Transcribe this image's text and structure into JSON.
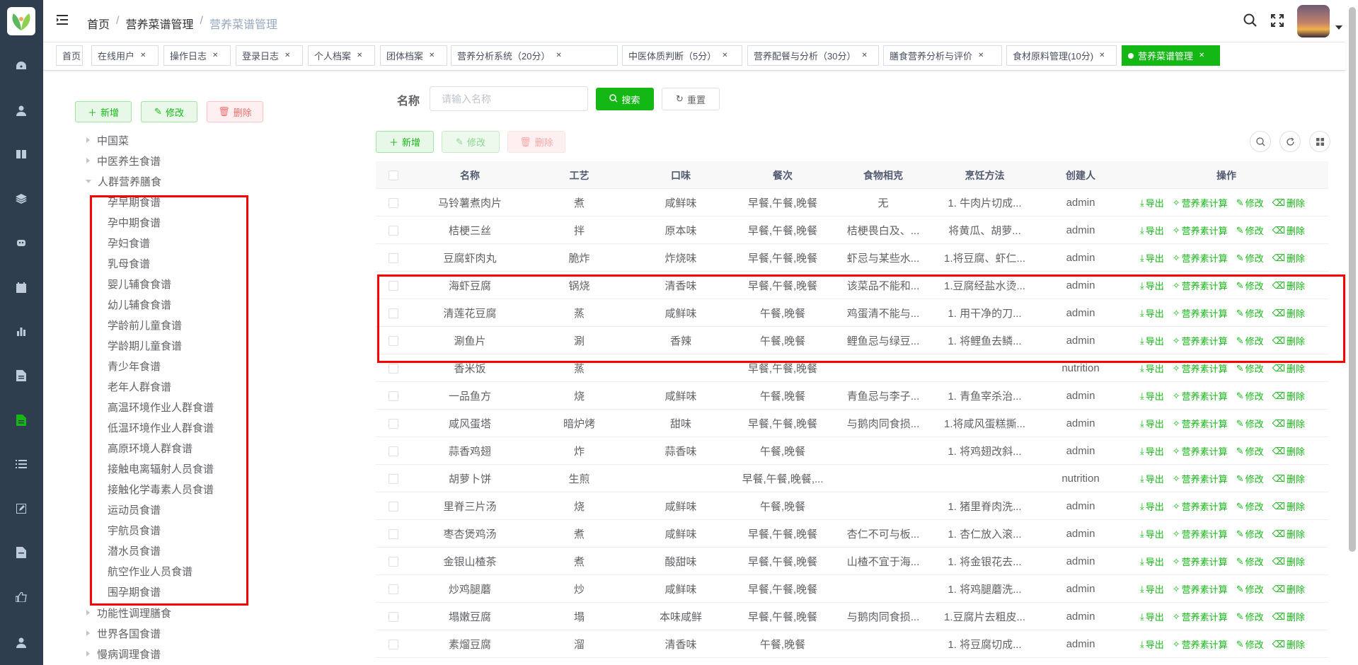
{
  "breadcrumb": {
    "home": "首页",
    "parent": "营养菜谱管理",
    "current": "营养菜谱管理"
  },
  "tags": [
    {
      "label": "首页",
      "closable": false
    },
    {
      "label": "在线用户",
      "closable": true
    },
    {
      "label": "操作日志",
      "closable": true
    },
    {
      "label": "登录日志",
      "closable": true
    },
    {
      "label": "个人档案",
      "closable": true
    },
    {
      "label": "团体档案",
      "closable": true
    },
    {
      "label": "营养分析系统（20分）",
      "closable": true
    },
    {
      "label": "中医体质判断（5分）",
      "closable": true
    },
    {
      "label": "营养配餐与分析（30分）",
      "closable": true
    },
    {
      "label": "膳食营养分析与评价",
      "closable": true
    },
    {
      "label": "食材原料管理(10分)",
      "closable": true
    },
    {
      "label": "营养菜谱管理",
      "closable": true,
      "active": true
    }
  ],
  "tree_toolbar": {
    "add": "新增",
    "edit": "修改",
    "delete": "删除"
  },
  "tree": {
    "top": [
      {
        "label": "中国菜",
        "expanded": false
      },
      {
        "label": "中医养生食谱",
        "expanded": false
      },
      {
        "label": "人群营养膳食",
        "expanded": true
      }
    ],
    "children": [
      "孕早期食谱",
      "孕中期食谱",
      "孕妇食谱",
      "乳母食谱",
      "婴儿辅食食谱",
      "幼儿辅食食谱",
      "学龄前儿童食谱",
      "学龄期儿童食谱",
      "青少年食谱",
      "老年人群食谱",
      "高温环境作业人群食谱",
      "低温环境作业人群食谱",
      "高原环境人群食谱",
      "接触电离辐射人员食谱",
      "接触化学毒素人员食谱",
      "运动员食谱",
      "宇航员食谱",
      "潜水员食谱",
      "航空作业人员食谱",
      "围孕期食谱"
    ],
    "bottom": [
      {
        "label": "功能性调理膳食",
        "expanded": false
      },
      {
        "label": "世界各国食谱",
        "expanded": false
      },
      {
        "label": "慢病调理食谱",
        "expanded": false
      }
    ]
  },
  "search": {
    "label": "名称",
    "placeholder": "请输入名称",
    "search_btn": "搜索",
    "reset_btn": "重置"
  },
  "table_toolbar": {
    "add": "新增",
    "edit": "修改",
    "delete": "删除"
  },
  "table": {
    "headers": [
      "名称",
      "工艺",
      "口味",
      "餐次",
      "食物相克",
      "烹饪方法",
      "创建人",
      "操作"
    ],
    "ops": {
      "export": "导出",
      "calc": "营养素计算",
      "edit": "修改",
      "delete": "删除"
    },
    "rows": [
      [
        "马铃薯煮肉片",
        "煮",
        "咸鲜味",
        "早餐,午餐,晚餐",
        "无",
        "1. 牛肉片切成...",
        "admin"
      ],
      [
        "桔梗三丝",
        "拌",
        "原本味",
        "早餐,午餐,晚餐",
        "桔梗畏白及、...",
        "将黄瓜、胡萝...",
        "admin"
      ],
      [
        "豆腐虾肉丸",
        "脆炸",
        "炸烧味",
        "早餐,午餐,晚餐",
        "虾忌与某些水...",
        "1.将豆腐、虾仁...",
        "admin"
      ],
      [
        "海虾豆腐",
        "锅烧",
        "清香味",
        "早餐,午餐,晚餐",
        "该菜品不能和...",
        "1.豆腐经盐水烫...",
        "admin"
      ],
      [
        "清莲花豆腐",
        "蒸",
        "咸鲜味",
        "午餐,晚餐",
        "鸡蛋清不能与...",
        "1. 用干净的刀...",
        "admin"
      ],
      [
        "涮鱼片",
        "涮",
        "香辣",
        "午餐,晚餐",
        "鲤鱼忌与绿豆...",
        "1. 将鲤鱼去鳞...",
        "admin"
      ],
      [
        "香米饭",
        "蒸",
        "",
        "早餐,午餐,晚餐",
        "",
        "",
        "nutrition"
      ],
      [
        "一品鱼方",
        "烧",
        "咸鲜味",
        "午餐,晚餐",
        "青鱼忌与李子...",
        "1. 青鱼宰杀治...",
        "admin"
      ],
      [
        "咸风蛋塔",
        "暗炉烤",
        "甜味",
        "早餐,午餐,晚餐",
        "与鹅肉同食损...",
        "1.将咸风蛋糕撕...",
        "admin"
      ],
      [
        "蒜香鸡翅",
        "炸",
        "蒜香味",
        "午餐,晚餐",
        "",
        "1. 将鸡翅改斜...",
        "admin"
      ],
      [
        "胡萝卜饼",
        "生煎",
        "",
        "早餐,午餐,晚餐,...",
        "",
        "",
        "nutrition"
      ],
      [
        "里脊三片汤",
        "烧",
        "咸鲜味",
        "午餐,晚餐",
        "",
        "1. 猪里脊肉洗...",
        "admin"
      ],
      [
        "枣杏煲鸡汤",
        "煮",
        "咸鲜味",
        "早餐,午餐,晚餐",
        "杏仁不可与板...",
        "1. 杏仁放入滚...",
        "admin"
      ],
      [
        "金银山楂茶",
        "煮",
        "酸甜味",
        "早餐,午餐,晚餐",
        "山楂不宜于海...",
        "1. 将金银花去...",
        "admin"
      ],
      [
        "炒鸡腿蘑",
        "炒",
        "咸鲜味",
        "早餐,午餐,晚餐",
        "",
        "1. 将鸡腿蘑洗...",
        "admin"
      ],
      [
        "塌嫩豆腐",
        "塌",
        "本味咸鲜",
        "早餐,午餐,晚餐",
        "与鹅肉同食损...",
        "1.豆腐片去粗皮...",
        "admin"
      ],
      [
        "素熘豆腐",
        "溜",
        "清香味",
        "午餐,晚餐",
        "",
        "1. 将豆腐切成...",
        "admin"
      ]
    ]
  },
  "colors": {
    "primary": "#14b814",
    "sidebar": "#2f3e4e",
    "highlight": "#ff0000"
  }
}
